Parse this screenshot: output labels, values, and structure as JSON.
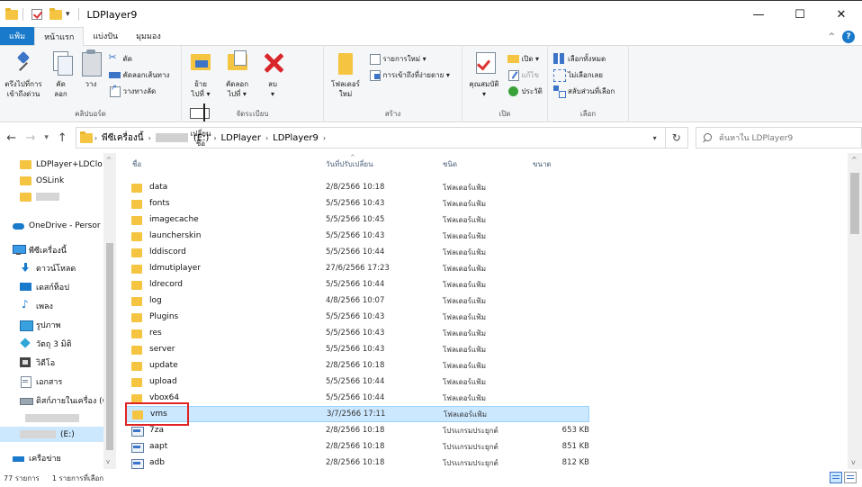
{
  "window": {
    "title": "LDPlayer9",
    "minimize": "—",
    "maximize": "☐",
    "close": "✕"
  },
  "ribbon_tabs": {
    "file": "แฟ้ม",
    "home": "หน้าแรก",
    "share": "แบ่งปัน",
    "view": "มุมมอง"
  },
  "ribbon": {
    "clipboard": {
      "label": "คลิปบอร์ด",
      "pin": "ตรึงไปที่การ\nเข้าถึงด่วน",
      "copy": "คัด\nลอก",
      "paste": "วาง",
      "cut": "ตัด",
      "copy_path": "คัดลอกเส้นทาง",
      "paste_shortcut": "วางทางลัด"
    },
    "organize": {
      "label": "จัดระเบียบ",
      "move_to": "ย้าย\nไปที่ ▾",
      "copy_to": "คัดลอก\nไปที่ ▾",
      "delete": "ลบ\n▾",
      "rename": "เปลี่ยน\nชื่อ"
    },
    "new": {
      "label": "สร้าง",
      "new_folder": "โฟลเดอร์\nใหม่",
      "new_item": "รายการใหม่ ▾",
      "easy_access": "การเข้าถึงที่ง่ายดาย ▾"
    },
    "open": {
      "label": "เปิด",
      "properties": "คุณสมบัติ\n▾",
      "open": "เปิด ▾",
      "edit": "แก้ไข",
      "history": "ประวัติ"
    },
    "select": {
      "label": "เลือก",
      "select_all": "เลือกทั้งหมด",
      "select_none": "ไม่เลือกเลย",
      "invert": "สลับส่วนที่เลือก"
    }
  },
  "address": {
    "this_pc": "พีซีเครื่องนี้",
    "drive": "(E:)",
    "crumb1": "LDPlayer",
    "crumb2": "LDPlayer9",
    "search_placeholder": "ค้นหาใน LDPlayer9"
  },
  "nav": {
    "items": [
      {
        "label": "LDPlayer+LDClo"
      },
      {
        "label": "OSLink"
      },
      {
        "label": "OneDrive - Persor"
      },
      {
        "label": "พีซีเครื่องนี้"
      },
      {
        "label": "ดาวน์โหลด"
      },
      {
        "label": "เดสก์ท็อป"
      },
      {
        "label": "เพลง"
      },
      {
        "label": "รูปภาพ"
      },
      {
        "label": "วัตถุ 3 มิติ"
      },
      {
        "label": "วิดีโอ"
      },
      {
        "label": "เอกสาร"
      },
      {
        "label": "ดิสก์ภายในเครื่อง (C"
      },
      {
        "label": "(E:)"
      },
      {
        "label": "เครือข่าย"
      }
    ]
  },
  "columns": {
    "name": "ชื่อ",
    "date": "วันที่ปรับเปลี่ยน",
    "type": "ชนิด",
    "size": "ขนาด"
  },
  "files": [
    {
      "name": "data",
      "date": "2/8/2566 10:18",
      "type": "โฟลเดอร์แฟ้ม",
      "size": ""
    },
    {
      "name": "fonts",
      "date": "5/5/2566 10:43",
      "type": "โฟลเดอร์แฟ้ม",
      "size": ""
    },
    {
      "name": "imagecache",
      "date": "5/5/2566 10:45",
      "type": "โฟลเดอร์แฟ้ม",
      "size": ""
    },
    {
      "name": "launcherskin",
      "date": "5/5/2566 10:43",
      "type": "โฟลเดอร์แฟ้ม",
      "size": ""
    },
    {
      "name": "lddiscord",
      "date": "5/5/2566 10:44",
      "type": "โฟลเดอร์แฟ้ม",
      "size": ""
    },
    {
      "name": "ldmutiplayer",
      "date": "27/6/2566 17:23",
      "type": "โฟลเดอร์แฟ้ม",
      "size": ""
    },
    {
      "name": "ldrecord",
      "date": "5/5/2566 10:44",
      "type": "โฟลเดอร์แฟ้ม",
      "size": ""
    },
    {
      "name": "log",
      "date": "4/8/2566 10:07",
      "type": "โฟลเดอร์แฟ้ม",
      "size": ""
    },
    {
      "name": "Plugins",
      "date": "5/5/2566 10:43",
      "type": "โฟลเดอร์แฟ้ม",
      "size": ""
    },
    {
      "name": "res",
      "date": "5/5/2566 10:43",
      "type": "โฟลเดอร์แฟ้ม",
      "size": ""
    },
    {
      "name": "server",
      "date": "5/5/2566 10:43",
      "type": "โฟลเดอร์แฟ้ม",
      "size": ""
    },
    {
      "name": "update",
      "date": "2/8/2566 10:18",
      "type": "โฟลเดอร์แฟ้ม",
      "size": ""
    },
    {
      "name": "upload",
      "date": "5/5/2566 10:44",
      "type": "โฟลเดอร์แฟ้ม",
      "size": ""
    },
    {
      "name": "vbox64",
      "date": "5/5/2566 10:44",
      "type": "โฟลเดอร์แฟ้ม",
      "size": ""
    },
    {
      "name": "vms",
      "date": "3/7/2566 17:11",
      "type": "โฟลเดอร์แฟ้ม",
      "size": ""
    },
    {
      "name": "7za",
      "date": "2/8/2566 10:18",
      "type": "โปรแกรมประยุกต์",
      "size": "653 KB"
    },
    {
      "name": "aapt",
      "date": "2/8/2566 10:18",
      "type": "โปรแกรมประยุกต์",
      "size": "851 KB"
    },
    {
      "name": "adb",
      "date": "2/8/2566 10:18",
      "type": "โปรแกรมประยุกต์",
      "size": "812 KB"
    }
  ],
  "status": {
    "count": "77 รายการ",
    "selected": "1 รายการที่เลือก"
  }
}
